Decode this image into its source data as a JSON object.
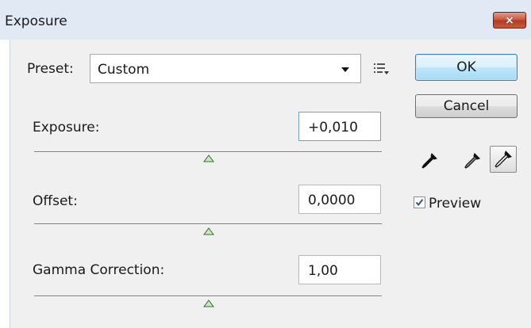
{
  "window": {
    "title": "Exposure",
    "close_icon": "×"
  },
  "preset": {
    "label": "Preset:",
    "value": "Custom"
  },
  "exposure": {
    "label": "Exposure:",
    "value": "+0,010"
  },
  "offset": {
    "label": "Offset:",
    "value": "0,0000"
  },
  "gamma": {
    "label": "Gamma Correction:",
    "value": "1,00"
  },
  "buttons": {
    "ok": "OK",
    "cancel": "Cancel"
  },
  "preview": {
    "label": "Preview",
    "checked": true
  },
  "icons": {
    "preset_menu": "list-menu-icon",
    "eyedroppers": [
      "black-point-eyedropper-icon",
      "gray-point-eyedropper-icon",
      "white-point-eyedropper-icon"
    ]
  },
  "colors": {
    "accent": "#3c7fb1",
    "titlebar": "#e1e9f4",
    "panel": "#f0f0f0",
    "close": "#c8523c"
  }
}
